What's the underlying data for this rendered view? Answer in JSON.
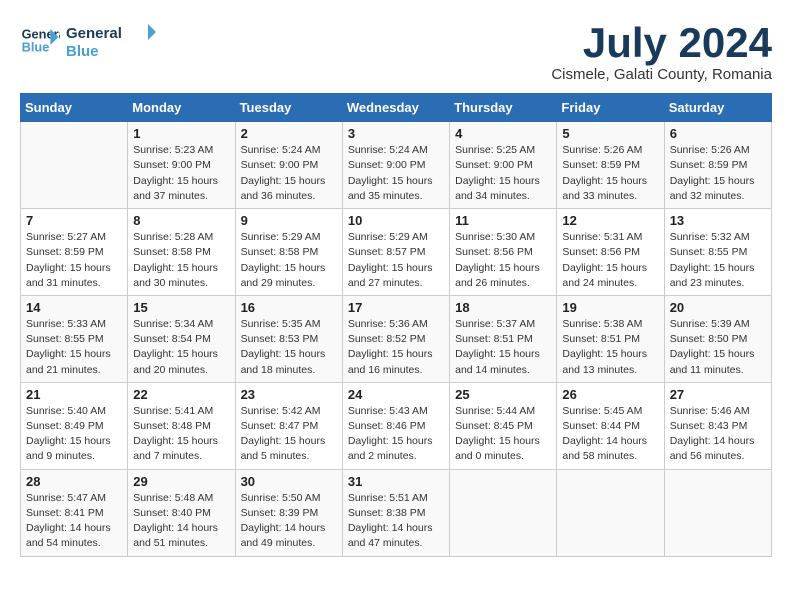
{
  "header": {
    "logo_line1": "General",
    "logo_line2": "Blue",
    "month": "July 2024",
    "location": "Cismele, Galati County, Romania"
  },
  "weekdays": [
    "Sunday",
    "Monday",
    "Tuesday",
    "Wednesday",
    "Thursday",
    "Friday",
    "Saturday"
  ],
  "weeks": [
    [
      {
        "day": "",
        "info": ""
      },
      {
        "day": "1",
        "info": "Sunrise: 5:23 AM\nSunset: 9:00 PM\nDaylight: 15 hours\nand 37 minutes."
      },
      {
        "day": "2",
        "info": "Sunrise: 5:24 AM\nSunset: 9:00 PM\nDaylight: 15 hours\nand 36 minutes."
      },
      {
        "day": "3",
        "info": "Sunrise: 5:24 AM\nSunset: 9:00 PM\nDaylight: 15 hours\nand 35 minutes."
      },
      {
        "day": "4",
        "info": "Sunrise: 5:25 AM\nSunset: 9:00 PM\nDaylight: 15 hours\nand 34 minutes."
      },
      {
        "day": "5",
        "info": "Sunrise: 5:26 AM\nSunset: 8:59 PM\nDaylight: 15 hours\nand 33 minutes."
      },
      {
        "day": "6",
        "info": "Sunrise: 5:26 AM\nSunset: 8:59 PM\nDaylight: 15 hours\nand 32 minutes."
      }
    ],
    [
      {
        "day": "7",
        "info": "Sunrise: 5:27 AM\nSunset: 8:59 PM\nDaylight: 15 hours\nand 31 minutes."
      },
      {
        "day": "8",
        "info": "Sunrise: 5:28 AM\nSunset: 8:58 PM\nDaylight: 15 hours\nand 30 minutes."
      },
      {
        "day": "9",
        "info": "Sunrise: 5:29 AM\nSunset: 8:58 PM\nDaylight: 15 hours\nand 29 minutes."
      },
      {
        "day": "10",
        "info": "Sunrise: 5:29 AM\nSunset: 8:57 PM\nDaylight: 15 hours\nand 27 minutes."
      },
      {
        "day": "11",
        "info": "Sunrise: 5:30 AM\nSunset: 8:56 PM\nDaylight: 15 hours\nand 26 minutes."
      },
      {
        "day": "12",
        "info": "Sunrise: 5:31 AM\nSunset: 8:56 PM\nDaylight: 15 hours\nand 24 minutes."
      },
      {
        "day": "13",
        "info": "Sunrise: 5:32 AM\nSunset: 8:55 PM\nDaylight: 15 hours\nand 23 minutes."
      }
    ],
    [
      {
        "day": "14",
        "info": "Sunrise: 5:33 AM\nSunset: 8:55 PM\nDaylight: 15 hours\nand 21 minutes."
      },
      {
        "day": "15",
        "info": "Sunrise: 5:34 AM\nSunset: 8:54 PM\nDaylight: 15 hours\nand 20 minutes."
      },
      {
        "day": "16",
        "info": "Sunrise: 5:35 AM\nSunset: 8:53 PM\nDaylight: 15 hours\nand 18 minutes."
      },
      {
        "day": "17",
        "info": "Sunrise: 5:36 AM\nSunset: 8:52 PM\nDaylight: 15 hours\nand 16 minutes."
      },
      {
        "day": "18",
        "info": "Sunrise: 5:37 AM\nSunset: 8:51 PM\nDaylight: 15 hours\nand 14 minutes."
      },
      {
        "day": "19",
        "info": "Sunrise: 5:38 AM\nSunset: 8:51 PM\nDaylight: 15 hours\nand 13 minutes."
      },
      {
        "day": "20",
        "info": "Sunrise: 5:39 AM\nSunset: 8:50 PM\nDaylight: 15 hours\nand 11 minutes."
      }
    ],
    [
      {
        "day": "21",
        "info": "Sunrise: 5:40 AM\nSunset: 8:49 PM\nDaylight: 15 hours\nand 9 minutes."
      },
      {
        "day": "22",
        "info": "Sunrise: 5:41 AM\nSunset: 8:48 PM\nDaylight: 15 hours\nand 7 minutes."
      },
      {
        "day": "23",
        "info": "Sunrise: 5:42 AM\nSunset: 8:47 PM\nDaylight: 15 hours\nand 5 minutes."
      },
      {
        "day": "24",
        "info": "Sunrise: 5:43 AM\nSunset: 8:46 PM\nDaylight: 15 hours\nand 2 minutes."
      },
      {
        "day": "25",
        "info": "Sunrise: 5:44 AM\nSunset: 8:45 PM\nDaylight: 15 hours\nand 0 minutes."
      },
      {
        "day": "26",
        "info": "Sunrise: 5:45 AM\nSunset: 8:44 PM\nDaylight: 14 hours\nand 58 minutes."
      },
      {
        "day": "27",
        "info": "Sunrise: 5:46 AM\nSunset: 8:43 PM\nDaylight: 14 hours\nand 56 minutes."
      }
    ],
    [
      {
        "day": "28",
        "info": "Sunrise: 5:47 AM\nSunset: 8:41 PM\nDaylight: 14 hours\nand 54 minutes."
      },
      {
        "day": "29",
        "info": "Sunrise: 5:48 AM\nSunset: 8:40 PM\nDaylight: 14 hours\nand 51 minutes."
      },
      {
        "day": "30",
        "info": "Sunrise: 5:50 AM\nSunset: 8:39 PM\nDaylight: 14 hours\nand 49 minutes."
      },
      {
        "day": "31",
        "info": "Sunrise: 5:51 AM\nSunset: 8:38 PM\nDaylight: 14 hours\nand 47 minutes."
      },
      {
        "day": "",
        "info": ""
      },
      {
        "day": "",
        "info": ""
      },
      {
        "day": "",
        "info": ""
      }
    ]
  ]
}
